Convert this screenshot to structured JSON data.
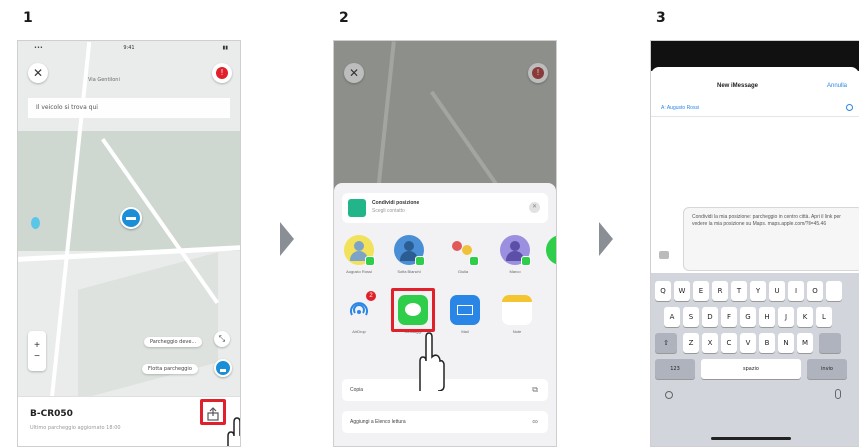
{
  "steps": [
    "1",
    "2",
    "3"
  ],
  "phone1": {
    "close_glyph": "✕",
    "search_hint": "Il veicolo si trova qui",
    "street_label_1": "Via Gentiloni",
    "chip_1": "Parcheggio deve...",
    "chip_2": "Flotta parcheggio",
    "card_title": "B-CR050",
    "card_sub": "Ultimo parcheggio aggiornato 18:00",
    "zoom_plus": "+",
    "zoom_minus": "−"
  },
  "phone2": {
    "close_glyph": "✕",
    "share_title": "Condividi posizione",
    "share_sub": "Scegli contatto",
    "close_small": "✕",
    "contacts": [
      "Augusto Rossi",
      "Sofia Bianchi",
      "Giulia",
      "Marco"
    ],
    "apps": [
      "AirDrop",
      "Messaggi",
      "Mail",
      "Note"
    ],
    "airdrop_badge": "2",
    "action_copy": "Copia",
    "action_reading": "Aggiungi a Elenco lettura"
  },
  "phone3": {
    "title": "New iMessage",
    "cancel": "Annulla",
    "to": "A: Augusto Rossi",
    "message": "Condividi la mia posizione: parcheggio in centro città. Apri il link per vedere la mia posizione su Maps. maps.apple.com/?ll=45.46",
    "keys_row1": [
      "Q",
      "W",
      "E",
      "R",
      "T",
      "Y",
      "U",
      "I",
      "O"
    ],
    "keys_row2": [
      "A",
      "S",
      "D",
      "F",
      "G",
      "H",
      "J",
      "K",
      "L"
    ],
    "keys_row3": [
      "Z",
      "X",
      "C",
      "V",
      "B",
      "N",
      "M"
    ],
    "key_shift": "⇧",
    "key_numbers": "123",
    "key_space": "spazio",
    "key_return": "invio"
  },
  "colors": {
    "highlight_red": "#e0212c",
    "brand_blue": "#1b8ed8",
    "messages_green": "#2fce4a"
  }
}
